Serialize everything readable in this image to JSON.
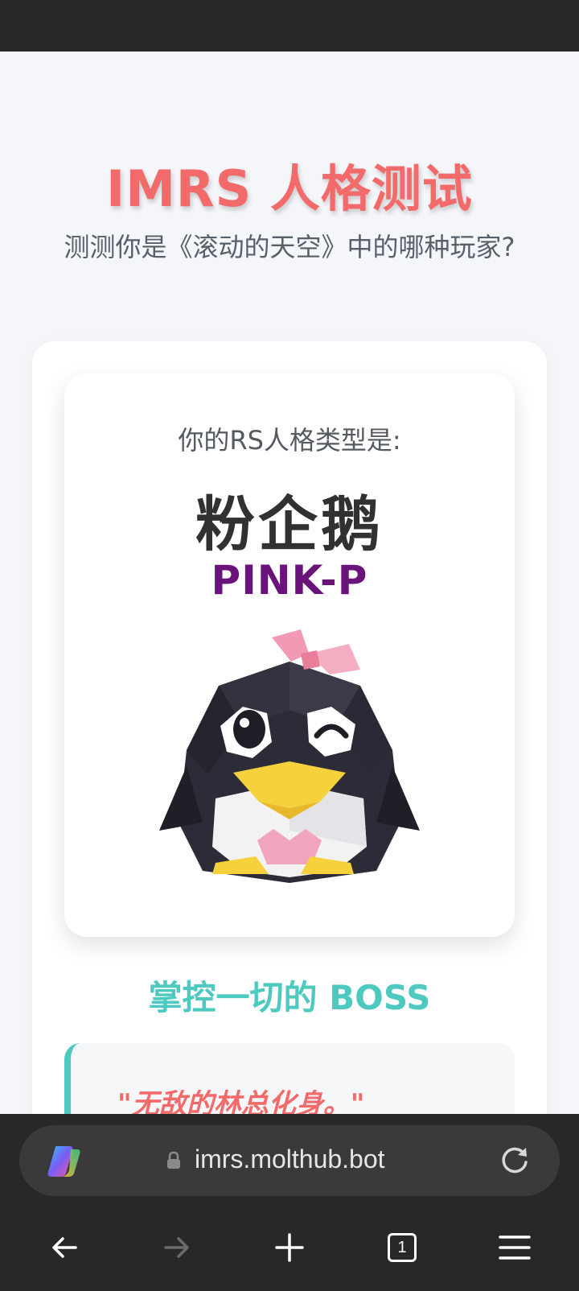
{
  "page": {
    "title": "IMRS 人格测试",
    "subtitle": "测测你是《滚动的天空》中的哪种玩家?"
  },
  "result": {
    "label": "你的RS人格类型是:",
    "name": "粉企鹅",
    "code": "PINK-P",
    "image_icon": "pink-bow-penguin"
  },
  "tagline": "掌控一切的 BOSS",
  "quote": "\"无敌的林总化身。\"",
  "browser": {
    "url": "imrs.molthub.bot",
    "tab_count": "1",
    "icons": [
      "copilot-icon",
      "lock-icon",
      "reload-icon",
      "back-icon",
      "forward-icon",
      "new-tab-icon",
      "tabs-icon",
      "menu-icon"
    ]
  },
  "colors": {
    "title": "#f26a6a",
    "accent": "#4ec9c0",
    "code": "#6a137a",
    "browser_bg": "#282828"
  }
}
